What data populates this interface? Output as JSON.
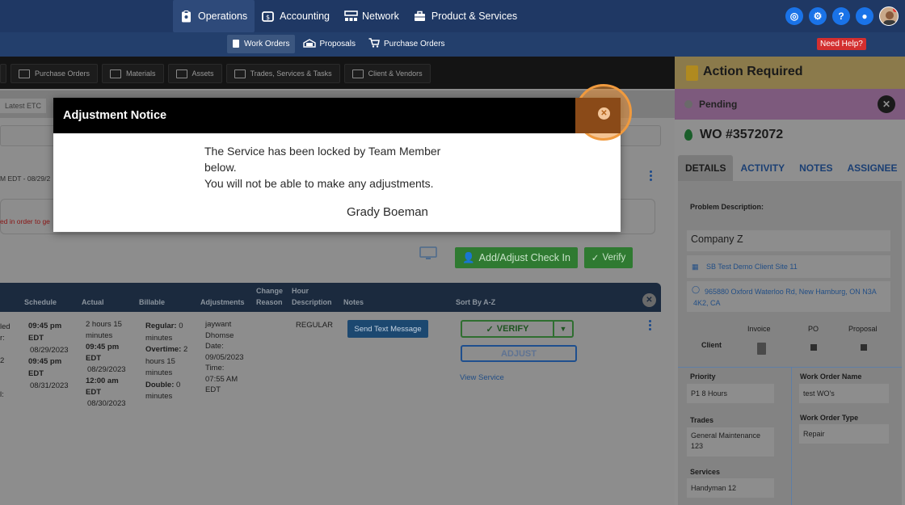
{
  "topnav": {
    "items": [
      {
        "label": "Operations",
        "icon": "clipboard-icon"
      },
      {
        "label": "Accounting",
        "icon": "money-icon"
      },
      {
        "label": "Network",
        "icon": "network-icon"
      },
      {
        "label": "Product & Services",
        "icon": "briefcase-icon"
      }
    ],
    "active": "Operations"
  },
  "subnav": {
    "items": [
      {
        "label": "Work Orders"
      },
      {
        "label": "Proposals"
      },
      {
        "label": "Purchase Orders"
      }
    ],
    "need_help": "Need Help?"
  },
  "tabs": [
    {
      "label": "Purchase Orders"
    },
    {
      "label": "Materials"
    },
    {
      "label": "Assets"
    },
    {
      "label": "Trades, Services & Tasks"
    },
    {
      "label": "Client & Vendors"
    }
  ],
  "filter": {
    "latest": "Latest ETC"
  },
  "background": {
    "date_fragment": "M EDT - 08/29/2",
    "red_message": "ed in order to ge",
    "add_adjust_label": "Add/Adjust Check In",
    "verify_label": "Verify"
  },
  "table": {
    "headers": {
      "schedule": "Schedule",
      "actual": "Actual",
      "billable": "Billable",
      "adjustments": "Adjustments",
      "change_reason_1": "Change",
      "change_reason_2": "Reason",
      "hour_desc_1": "Hour",
      "hour_desc_2": "Description",
      "notes": "Notes",
      "sort": "Sort By A-Z"
    },
    "row": {
      "left_frag_1": "led",
      "left_frag_2": "r:",
      "left_frag_3": "2",
      "left_frag_4": "l:",
      "schedule_1_time": "09:45 pm",
      "schedule_1_tz": "EDT",
      "schedule_1_date": "08/29/2023",
      "schedule_2_time": "09:45 pm",
      "schedule_2_tz": "EDT",
      "schedule_2_date": "08/31/2023",
      "actual_1": "2 hours 15",
      "actual_2": "minutes",
      "actual_3_time": "09:45 pm",
      "actual_3_tz": "EDT",
      "actual_3_date": "08/29/2023",
      "actual_4_time": "12:00 am",
      "actual_4_tz": "EDT",
      "actual_4_date": "08/30/2023",
      "billable_regular_label": "Regular:",
      "billable_regular_val": "0",
      "billable_regular_unit": "minutes",
      "billable_overtime_label": "Overtime:",
      "billable_overtime_val": "2",
      "billable_overtime_2": "hours 15",
      "billable_overtime_3": "minutes",
      "billable_double_label": "Double:",
      "billable_double_val": "0",
      "billable_double_unit": "minutes",
      "adj_1": "jaywant",
      "adj_2": "Dhomse",
      "adj_3": "Date:",
      "adj_4": "09/05/2023",
      "adj_5": "Time:",
      "adj_6": "07:55 AM",
      "adj_7": "EDT",
      "hour_description": "REGULAR",
      "send_text": "Send Text Message",
      "verify": "VERIFY",
      "adjust": "ADJUST",
      "view_service": "View Service"
    }
  },
  "right_panel": {
    "action_required": "Action Required",
    "status": "Pending",
    "wo_number": "WO #3572072",
    "tabs": [
      "DETAILS",
      "ACTIVITY",
      "NOTES",
      "ASSIGNEE"
    ],
    "problem_label": "Problem Description:",
    "company": "Company Z",
    "site": "SB Test Demo Client Site 11",
    "address_1": "965880 Oxford Waterloo Rd, New Hamburg, ON N3A",
    "address_2": "4K2, CA",
    "col_invoice": "Invoice",
    "col_po": "PO",
    "col_proposal": "Proposal",
    "client_label": "Client",
    "priority_label": "Priority",
    "priority_value": "P1 8 Hours",
    "wo_name_label": "Work Order Name",
    "wo_name_value": "test WO's",
    "trades_label": "Trades",
    "trades_value_1": "General Maintenance",
    "trades_value_2": "123",
    "wo_type_label": "Work Order Type",
    "wo_type_value": "Repair",
    "services_label": "Services",
    "services_value": "Handyman 12"
  },
  "modal": {
    "title": "Adjustment Notice",
    "line_1": "The Service has been locked by Team Member",
    "line_2": "below.",
    "line_3": "You will not be able to make any adjustments.",
    "member": "Grady Boeman"
  },
  "colors": {
    "topbar": "#1f3864",
    "modal_header": "#000000",
    "highlight": "#f09a3e",
    "verify_green": "#2f7a31"
  }
}
